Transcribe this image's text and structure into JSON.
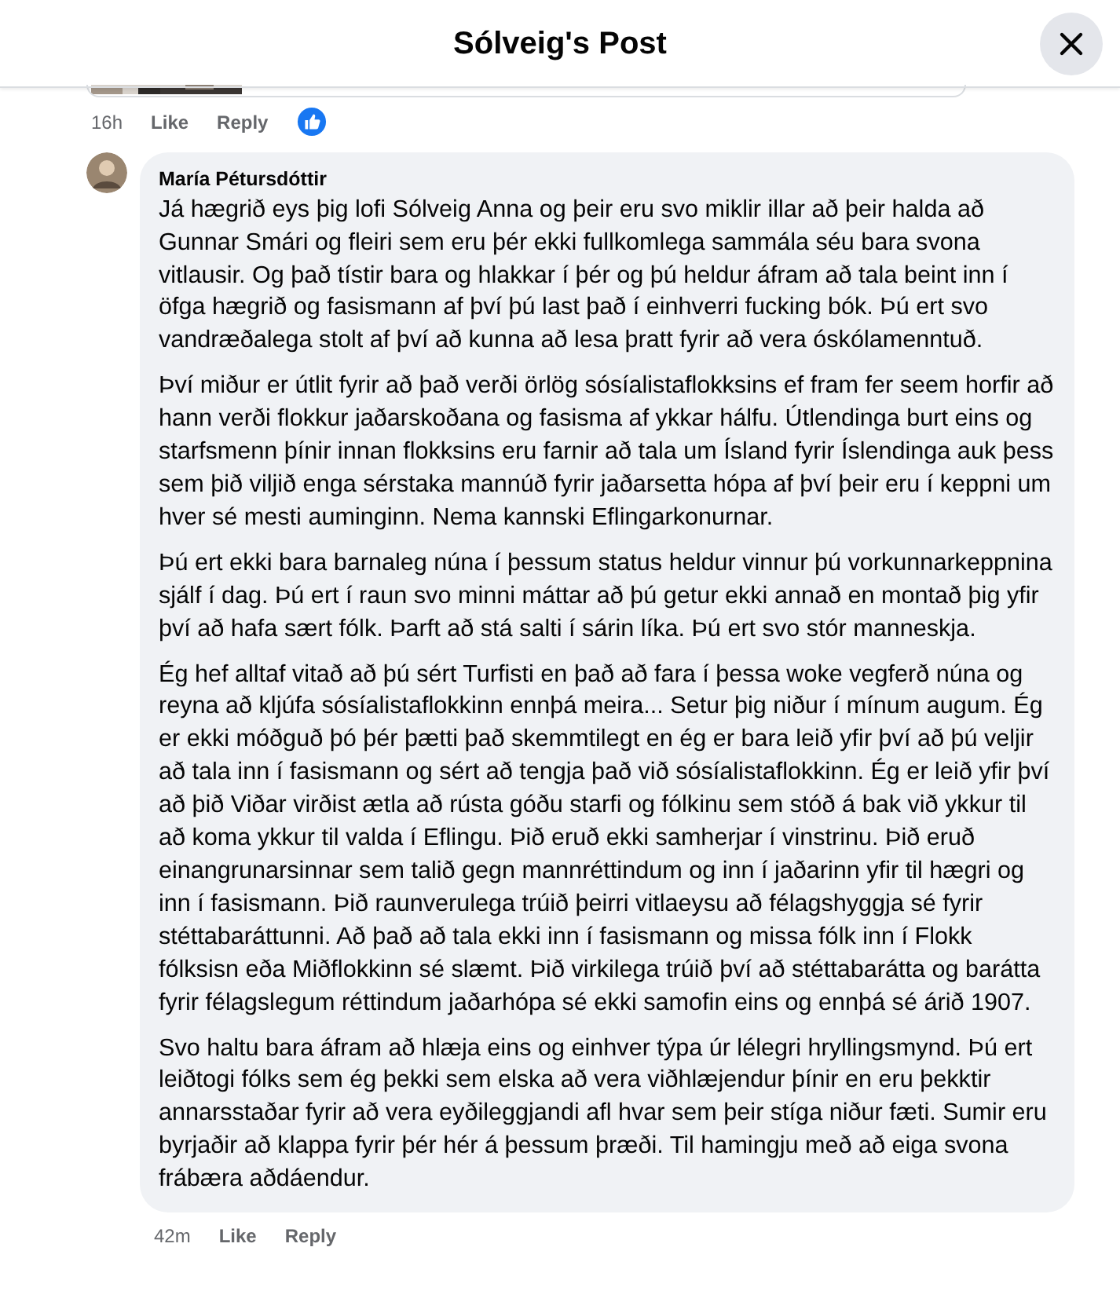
{
  "header": {
    "title": "Sólveig's Post"
  },
  "previous_comment": {
    "has_picture": true,
    "time": "16h",
    "actions": [
      "Like",
      "Reply"
    ],
    "liked": true
  },
  "comment": {
    "author": "María Pétursdóttir",
    "paragraphs": [
      "Já hægrið eys þig lofi Sólveig Anna og þeir eru svo miklir illar að þeir halda að Gunnar Smári og fleiri sem eru þér ekki fullkomlega sammála séu bara svona vitlausir. Og það tístir bara og hlakkar í þér og þú heldur áfram að tala beint inn í öfga hægrið og fasismann af því þú last það í einhverri fucking bók. Þú ert svo vandræðalega stolt af því að kunna að lesa þratt fyrir að vera óskólamenntuð.",
      "Því miður er útlit fyrir að það verði örlög sósíalistaflokksins ef fram fer seem horfir að hann verði flokkur jaðarskoðana og fasisma af ykkar hálfu. Útlendinga burt eins og starfsmenn þínir innan flokksins eru farnir að tala um Ísland fyrir Íslendinga auk þess sem þið viljið enga sérstaka mannúð fyrir jaðarsetta hópa af því þeir eru í keppni um hver sé mesti auminginn. Nema kannski Eflingarkonurnar.",
      "Þú ert ekki bara barnaleg núna í þessum status heldur vinnur þú vorkunnarkeppnina sjálf í dag. Þú ert í raun svo minni máttar að þú getur ekki annað en montað þig yfir því að hafa sært fólk. Þarft að stá salti í sárin líka. Þú ert svo stór manneskja.",
      "Ég hef alltaf vitað að þú sért Turfisti en það að fara í þessa woke vegferð núna og reyna að kljúfa sósíalistaflokkinn ennþá meira... Setur þig niður í mínum augum. Ég er ekki móðguð þó þér þætti það skemmtilegt en ég er bara leið yfir því að þú veljir að tala inn í fasismann og sért að tengja það við sósíalistaflokkinn. Ég er leið yfir því að þið Viðar virðist ætla að rústa góðu starfi og fólkinu sem stóð á bak við ykkur til að koma ykkur til valda í Eflingu. Þið eruð ekki samherjar í vinstrinu. Þið eruð einangrunarsinnar sem talið gegn mannréttindum og inn í jaðarinn yfir til hægri og inn í fasismann. Þið raunverulega trúið þeirri vitlaeysu að félagshyggja sé fyrir stéttabaráttunni. Að það að tala ekki inn í fasismann og missa fólk inn í Flokk fólksisn eða Miðflokkinn sé slæmt. Þið virkilega trúið því að stéttabarátta og barátta fyrir félagslegum réttindum jaðarhópa sé ekki samofin eins og ennþá sé árið 1907.",
      "Svo haltu bara áfram að hlæja eins og einhver týpa úr lélegri hryllingsmynd. Þú ert leiðtogi fólks sem ég þekki sem elska að vera viðhlæjendur þínir en eru þekktir annarsstaðar fyrir að vera eyðileggjandi afl hvar sem þeir stíga niður fæti. Sumir eru byrjaðir að klappa fyrir þér hér á þessum þræði. Til hamingju með að eiga svona frábæra aðdáendur."
    ],
    "time": "42m",
    "actions": [
      "Like",
      "Reply"
    ]
  }
}
